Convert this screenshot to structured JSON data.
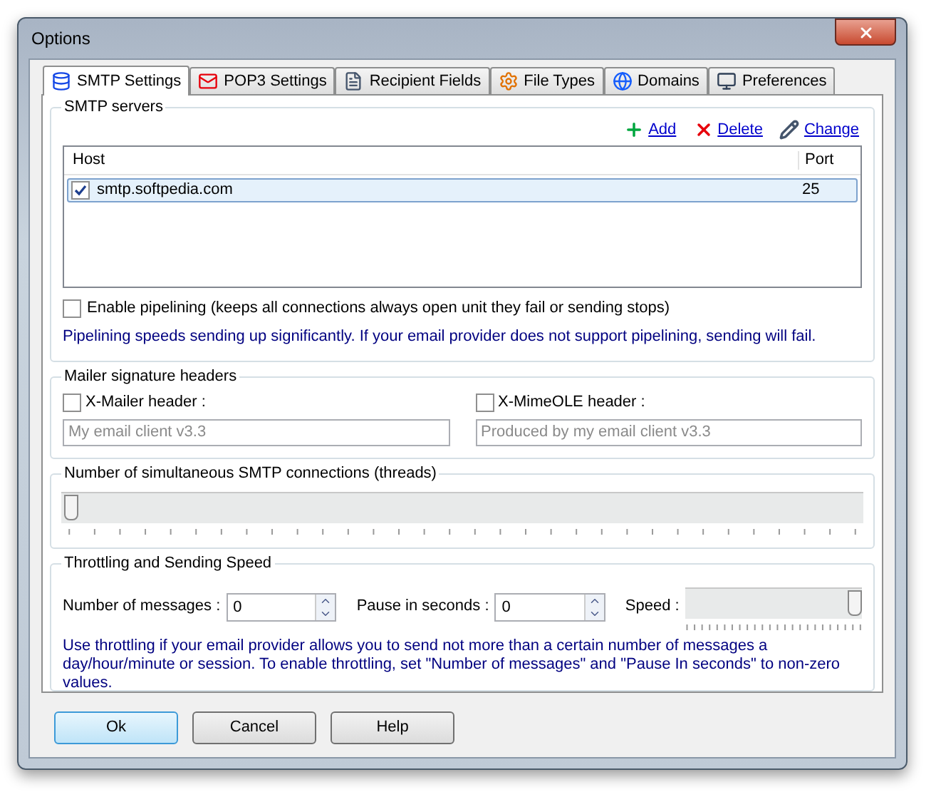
{
  "window": {
    "title": "Options"
  },
  "tabs": [
    {
      "label": "SMTP Settings",
      "selected": true
    },
    {
      "label": "POP3 Settings",
      "selected": false
    },
    {
      "label": "Recipient Fields",
      "selected": false
    },
    {
      "label": "File Types",
      "selected": false
    },
    {
      "label": "Domains",
      "selected": false
    },
    {
      "label": "Preferences",
      "selected": false
    }
  ],
  "smtp_servers": {
    "title": "SMTP servers",
    "actions": [
      {
        "label": "Add"
      },
      {
        "label": "Delete"
      },
      {
        "label": "Change"
      }
    ],
    "columns": [
      "Host",
      "Port"
    ],
    "rows": [
      {
        "host": "smtp.softpedia.com",
        "port": "25",
        "checked": true,
        "selected": true
      }
    ],
    "pipelining": {
      "label": "Enable pipelining (keeps all connections always open unit they fail or sending stops)",
      "checked": false
    },
    "note": "Pipelining speeds sending up significantly. If your email provider does not support pipelining, sending will fail."
  },
  "mailer_headers": {
    "title": "Mailer signature headers",
    "items": [
      {
        "label": "X-Mailer header :",
        "checked": false,
        "placeholder": "My email client v3.3"
      },
      {
        "label": "X-MimeOLE header :",
        "checked": false,
        "placeholder": "Produced by my email client v3.3"
      }
    ]
  },
  "threads": {
    "title": "Number of simultaneous SMTP connections (threads)",
    "level": 0
  },
  "throttling": {
    "title": "Throttling and Sending Speed",
    "messages": {
      "label": "Number of messages :",
      "value": "0"
    },
    "pause": {
      "label": "Pause in seconds :",
      "value": "0"
    },
    "speed": {
      "label": "Speed :",
      "level": 1
    },
    "note": "Use throttling if your email provider allows you to send not more than a certain number of messages a day/hour/minute or session. To enable throttling, set \"Number of messages\" and \"Pause In seconds\" to non-zero values."
  },
  "buttons": [
    {
      "label": "Ok",
      "default": true
    },
    {
      "label": "Cancel",
      "default": false
    },
    {
      "label": "Help",
      "default": false
    }
  ]
}
